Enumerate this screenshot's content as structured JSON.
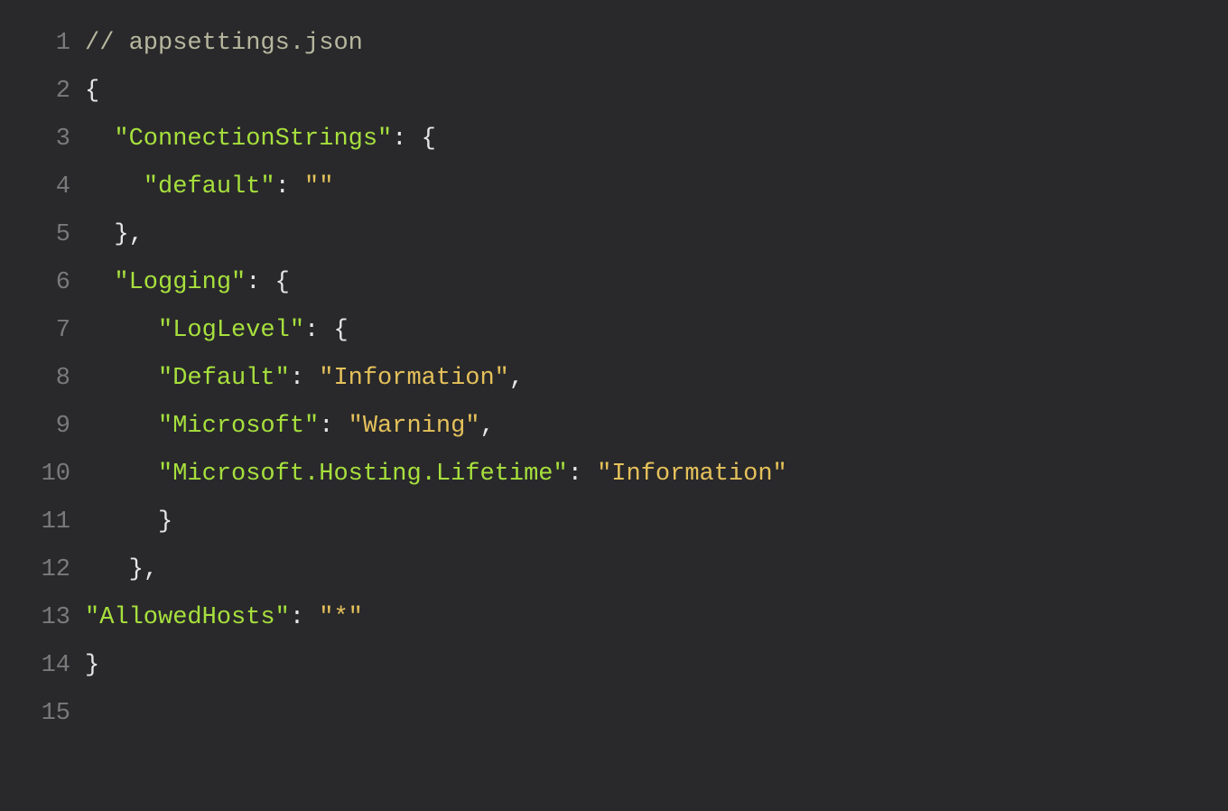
{
  "lineNumbers": {
    "l1": "1",
    "l2": "2",
    "l3": "3",
    "l4": "4",
    "l5": "5",
    "l6": "6",
    "l7": "7",
    "l8": "8",
    "l9": "9",
    "l10": "10",
    "l11": "11",
    "l12": "12",
    "l13": "13",
    "l14": "14",
    "l15": "15"
  },
  "code": {
    "l1": {
      "comment": "// appsettings.json"
    },
    "l2": {
      "brace": "{"
    },
    "l3": {
      "indent": "  ",
      "key": "\"ConnectionStrings\"",
      "colon": ": ",
      "brace": "{"
    },
    "l4": {
      "indent": "    ",
      "key": "\"default\"",
      "colon": ": ",
      "val": "\"\""
    },
    "l5": {
      "indent": "  ",
      "brace": "}",
      "comma": ","
    },
    "l6": {
      "indent": "  ",
      "key": "\"Logging\"",
      "colon": ": ",
      "brace": "{"
    },
    "l7": {
      "indent": "     ",
      "key": "\"LogLevel\"",
      "colon": ": ",
      "brace": "{"
    },
    "l8": {
      "indent": "     ",
      "key": "\"Default\"",
      "colon": ": ",
      "val": "\"Information\"",
      "comma": ","
    },
    "l9": {
      "indent": "     ",
      "key": "\"Microsoft\"",
      "colon": ": ",
      "val": "\"Warning\"",
      "comma": ","
    },
    "l10": {
      "indent": "     ",
      "key": "\"Microsoft.Hosting.Lifetime\"",
      "colon": ": ",
      "val": "\"Information\""
    },
    "l11": {
      "indent": "     ",
      "brace": "}"
    },
    "l12": {
      "indent": "   ",
      "brace": "}",
      "comma": ","
    },
    "l13": {
      "key": "\"AllowedHosts\"",
      "colon": ": ",
      "val": "\"*\""
    },
    "l14": {
      "brace": "}"
    }
  }
}
